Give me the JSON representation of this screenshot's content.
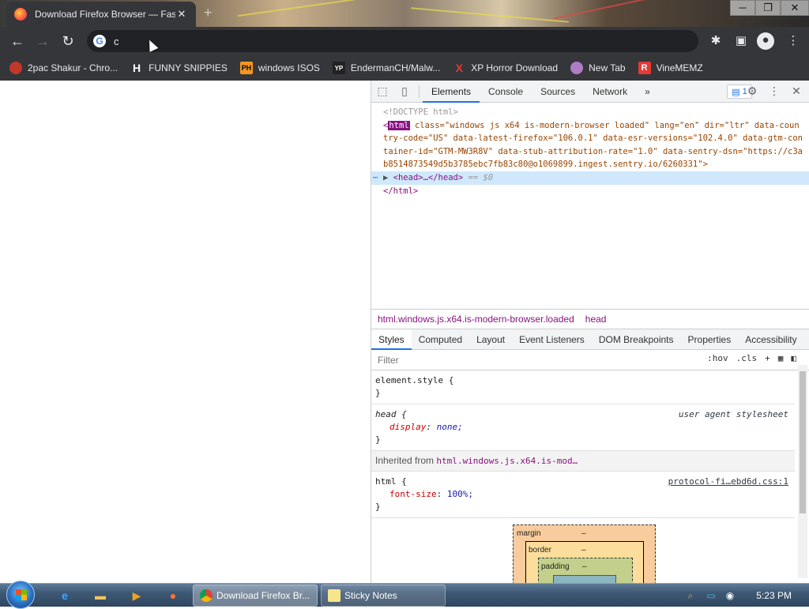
{
  "browser": {
    "tab_title": "Download Firefox Browser — Fast, Private & Free",
    "tab_close": "✕",
    "new_tab": "+",
    "window_controls": {
      "minimize": "─",
      "restore": "❐",
      "close": "✕"
    },
    "address_value": "c",
    "address_icon": "G"
  },
  "bookmarks": [
    {
      "label": "2pac Shakur - Chro...",
      "icon": "bookmark-2pac-icon",
      "badge": "",
      "color": "#c0392b"
    },
    {
      "label": "FUNNY SNIPPIES",
      "icon": "bookmark-h-icon",
      "badge": "H",
      "color": "#ffffff"
    },
    {
      "label": "windows ISOS",
      "icon": "bookmark-ph-icon",
      "badge": "PH",
      "color": "#f7971d"
    },
    {
      "label": "EndermanCH/Malw...",
      "icon": "bookmark-yp-icon",
      "badge": "YP",
      "color": "#222222"
    },
    {
      "label": "XP Horror Download",
      "icon": "bookmark-x-icon",
      "badge": "X",
      "color": "#e53935"
    },
    {
      "label": "New Tab",
      "icon": "bookmark-newtab-icon",
      "badge": "",
      "color": "#b07cc6"
    },
    {
      "label": "VineMEMZ",
      "icon": "bookmark-vine-icon",
      "badge": "R",
      "color": "#e53935"
    }
  ],
  "devtools": {
    "tabs": [
      "Elements",
      "Console",
      "Sources",
      "Network"
    ],
    "more": "»",
    "issues_count": "1",
    "dom": {
      "doctype": "<!DOCTYPE html>",
      "html_tag": "html",
      "html_attrs": " class=\"windows js x64 is-modern-browser loaded\" lang=\"en\" dir=\"ltr\" data-country-code=\"US\" data-latest-firefox=\"106.0.1\" data-esr-versions=\"102.4.0\" data-gtm-container-id=\"GTM-MW3R8V\" data-stub-attribution-rate=\"1.0\" data-sentry-dsn=\"https://c3ab8514873549d5b3785ebc7fb83c80@o1069899.ingest.sentry.io/6260331\">",
      "head_line": "<head>…</head>",
      "head_eq": " == $0",
      "html_close": "</html>"
    },
    "breadcrumbs": [
      "html.windows.js.x64.is-modern-browser.loaded",
      "head"
    ],
    "subtabs": [
      "Styles",
      "Computed",
      "Layout",
      "Event Listeners",
      "DOM Breakpoints",
      "Properties",
      "Accessibility"
    ],
    "filter_placeholder": "Filter",
    "filter_tools": [
      ":hov",
      ".cls",
      "+"
    ],
    "styles": {
      "element_style": "element.style {",
      "close_brace": "}",
      "head_selector": "head {",
      "head_source": "user agent stylesheet",
      "head_prop": "display",
      "head_val": "none;",
      "inherited_label": "Inherited from ",
      "inherited_selector": "html.windows.js.x64.is-mod…",
      "html_selector": "html {",
      "html_source": "protocol-fi…ebd6d.css:1",
      "html_prop": "font-size",
      "html_val": "100%;"
    },
    "boxmodel": {
      "margin": "margin",
      "border": "border",
      "padding": "padding",
      "dash": "–"
    }
  },
  "taskbar": {
    "buttons": [
      {
        "label": "Download Firefox Br...",
        "active": true
      },
      {
        "label": "Sticky Notes",
        "active": false
      }
    ],
    "clock": "5:23 PM"
  }
}
